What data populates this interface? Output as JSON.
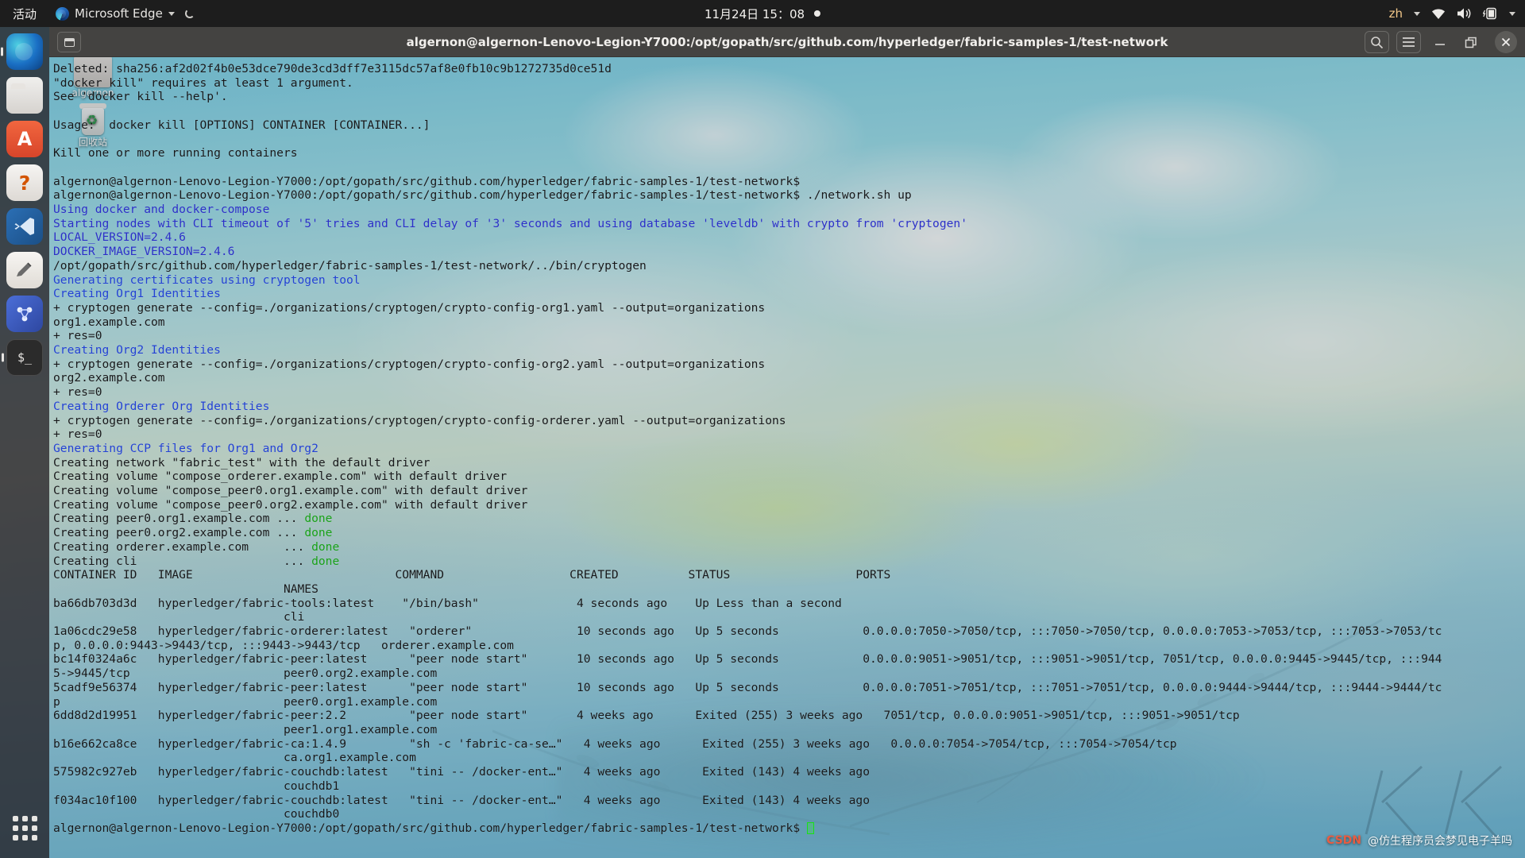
{
  "topbar": {
    "activities": "活动",
    "app_name": "Microsoft Edge",
    "clock": "11月24日  15：08",
    "language": "zh"
  },
  "desktop": {
    "icons": [
      {
        "name": "home-folder",
        "label": "algernon"
      },
      {
        "name": "trash",
        "label": "回收站"
      }
    ]
  },
  "dock": {
    "items": [
      {
        "name": "microsoft-edge",
        "label": "Microsoft Edge"
      },
      {
        "name": "files",
        "label": "文件"
      },
      {
        "name": "ubuntu-software",
        "label": "A"
      },
      {
        "name": "help",
        "label": "?"
      },
      {
        "name": "visual-studio-code",
        "label": "VS Code"
      },
      {
        "name": "text-editor",
        "label": "Text Editor"
      },
      {
        "name": "fabric-app",
        "label": "Fabric"
      },
      {
        "name": "terminal",
        "label": "$_"
      }
    ],
    "show_apps_label": "显示应用程序"
  },
  "terminal": {
    "title": "algernon@algernon-Lenovo-Legion-Y7000:/opt/gopath/src/github.com/hyperledger/fabric-samples-1/test-network",
    "titlebar_buttons": {
      "new_tab": "new-tab",
      "search": "search",
      "menu": "menu",
      "minimize": "minimize",
      "maximize": "maximize",
      "close": "close"
    },
    "prompt": "algernon@algernon-Lenovo-Legion-Y7000:/opt/gopath/src/github.com/hyperledger/fabric-samples-1/test-network$",
    "lines": [
      {
        "color": "default",
        "text": "Deleted: sha256:af2d02f4b0e53dce790de3cd3dff7e3115dc57af8e0fb10c9b1272735d0ce51d"
      },
      {
        "color": "default",
        "text": "\"docker kill\" requires at least 1 argument."
      },
      {
        "color": "default",
        "text": "See 'docker kill --help'."
      },
      {
        "color": "default",
        "text": ""
      },
      {
        "color": "default",
        "text": "Usage:  docker kill [OPTIONS] CONTAINER [CONTAINER...]"
      },
      {
        "color": "default",
        "text": ""
      },
      {
        "color": "default",
        "text": "Kill one or more running containers"
      },
      {
        "color": "default",
        "text": ""
      },
      {
        "color": "default",
        "text": "algernon@algernon-Lenovo-Legion-Y7000:/opt/gopath/src/github.com/hyperledger/fabric-samples-1/test-network$"
      },
      {
        "color": "default",
        "text": "algernon@algernon-Lenovo-Legion-Y7000:/opt/gopath/src/github.com/hyperledger/fabric-samples-1/test-network$ ./network.sh up"
      },
      {
        "color": "blue",
        "text": "Using docker and docker-compose"
      },
      {
        "color": "blue",
        "text": "Starting nodes with CLI timeout of '5' tries and CLI delay of '3' seconds and using database 'leveldb' with crypto from 'cryptogen'"
      },
      {
        "color": "blue",
        "text": "LOCAL_VERSION=2.4.6"
      },
      {
        "color": "blue",
        "text": "DOCKER_IMAGE_VERSION=2.4.6"
      },
      {
        "color": "default",
        "text": "/opt/gopath/src/github.com/hyperledger/fabric-samples-1/test-network/../bin/cryptogen"
      },
      {
        "color": "cyan",
        "text": "Generating certificates using cryptogen tool"
      },
      {
        "color": "cyan",
        "text": "Creating Org1 Identities"
      },
      {
        "color": "default",
        "text": "+ cryptogen generate --config=./organizations/cryptogen/crypto-config-org1.yaml --output=organizations"
      },
      {
        "color": "default",
        "text": "org1.example.com"
      },
      {
        "color": "default",
        "text": "+ res=0"
      },
      {
        "color": "cyan",
        "text": "Creating Org2 Identities"
      },
      {
        "color": "default",
        "text": "+ cryptogen generate --config=./organizations/cryptogen/crypto-config-org2.yaml --output=organizations"
      },
      {
        "color": "default",
        "text": "org2.example.com"
      },
      {
        "color": "default",
        "text": "+ res=0"
      },
      {
        "color": "cyan",
        "text": "Creating Orderer Org Identities"
      },
      {
        "color": "default",
        "text": "+ cryptogen generate --config=./organizations/cryptogen/crypto-config-orderer.yaml --output=organizations"
      },
      {
        "color": "default",
        "text": "+ res=0"
      },
      {
        "color": "cyan",
        "text": "Generating CCP files for Org1 and Org2"
      },
      {
        "color": "default",
        "text": "Creating network \"fabric_test\" with the default driver"
      },
      {
        "color": "default",
        "text": "Creating volume \"compose_orderer.example.com\" with default driver"
      },
      {
        "color": "default",
        "text": "Creating volume \"compose_peer0.org1.example.com\" with default driver"
      },
      {
        "color": "default",
        "text": "Creating volume \"compose_peer0.org2.example.com\" with default driver"
      },
      {
        "color": "mixed-done",
        "text": "Creating peer0.org1.example.com ... ",
        "suffix": "done"
      },
      {
        "color": "mixed-done",
        "text": "Creating peer0.org2.example.com ... ",
        "suffix": "done"
      },
      {
        "color": "mixed-done",
        "text": "Creating orderer.example.com     ... ",
        "suffix": "done"
      },
      {
        "color": "mixed-done",
        "text": "Creating cli                     ... ",
        "suffix": "done"
      }
    ],
    "docker_ps": {
      "header_line_1": "CONTAINER ID   IMAGE                             COMMAND                  CREATED          STATUS                  PORTS",
      "header_line_2": "                                 NAMES",
      "rows": [
        {
          "line1": "ba66db703d3d   hyperledger/fabric-tools:latest    \"/bin/bash\"              4 seconds ago    Up Less than a second",
          "line2": "                                 cli"
        },
        {
          "line1": "1a06cdc29e58   hyperledger/fabric-orderer:latest   \"orderer\"               10 seconds ago   Up 5 seconds            0.0.0.0:7050->7050/tcp, :::7050->7050/tcp, 0.0.0.0:7053->7053/tcp, :::7053->7053/tc",
          "line2": "p, 0.0.0.0:9443->9443/tcp, :::9443->9443/tcp   orderer.example.com"
        },
        {
          "line1": "bc14f0324a6c   hyperledger/fabric-peer:latest      \"peer node start\"       10 seconds ago   Up 5 seconds            0.0.0.0:9051->9051/tcp, :::9051->9051/tcp, 7051/tcp, 0.0.0.0:9445->9445/tcp, :::944",
          "line2": "5->9445/tcp                      peer0.org2.example.com"
        },
        {
          "line1": "5cadf9e56374   hyperledger/fabric-peer:latest      \"peer node start\"       10 seconds ago   Up 5 seconds            0.0.0.0:7051->7051/tcp, :::7051->7051/tcp, 0.0.0.0:9444->9444/tcp, :::9444->9444/tc",
          "line2": "p                                peer0.org1.example.com"
        },
        {
          "line1": "6dd8d2d19951   hyperledger/fabric-peer:2.2         \"peer node start\"       4 weeks ago      Exited (255) 3 weeks ago   7051/tcp, 0.0.0.0:9051->9051/tcp, :::9051->9051/tcp",
          "line2": "                                 peer1.org1.example.com"
        },
        {
          "line1": "b16e662ca8ce   hyperledger/fabric-ca:1.4.9         \"sh -c 'fabric-ca-se…\"   4 weeks ago      Exited (255) 3 weeks ago   0.0.0.0:7054->7054/tcp, :::7054->7054/tcp",
          "line2": "                                 ca.org1.example.com"
        },
        {
          "line1": "575982c927eb   hyperledger/fabric-couchdb:latest   \"tini -- /docker-ent…\"   4 weeks ago      Exited (143) 4 weeks ago",
          "line2": "                                 couchdb1"
        },
        {
          "line1": "f034ac10f100   hyperledger/fabric-couchdb:latest   \"tini -- /docker-ent…\"   4 weeks ago      Exited (143) 4 weeks ago",
          "line2": "                                 couchdb0"
        }
      ]
    }
  },
  "watermark": {
    "site": "CSDN",
    "author": "@仿生程序员会梦见电子羊吗"
  },
  "colors": {
    "topbar_bg": "#1d1d1d",
    "titlebar_bg": "#444341",
    "terminal_blue": "#2b2fc8",
    "terminal_cyan": "#2342d4",
    "terminal_green": "#18a118",
    "accent_orange": "#e85c41"
  }
}
